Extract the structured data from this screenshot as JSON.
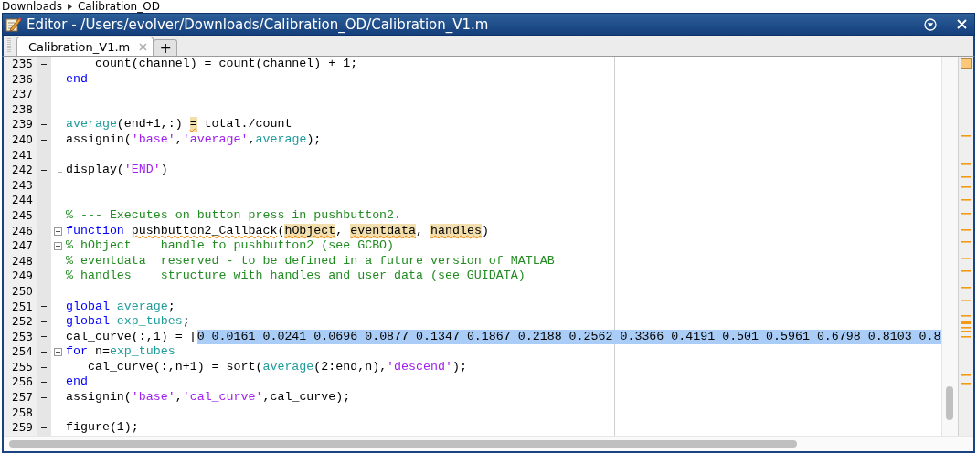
{
  "breadcrumb": [
    {
      "label": "Downloads"
    },
    {
      "label": "Calibration_OD"
    }
  ],
  "window": {
    "title": "Editor - /Users/evolver/Downloads/Calibration_OD/Calibration_V1.m"
  },
  "tabs": [
    {
      "label": "Calibration_V1.m",
      "selected": true
    }
  ],
  "new_tab_label": "+",
  "code_lines": [
    {
      "number": "235",
      "executable": true,
      "in_block": true,
      "tokens": [
        {
          "kind": "plain",
          "text": "    count(channel) = count(channel) + 1;"
        }
      ]
    },
    {
      "number": "236",
      "executable": true,
      "in_block": true,
      "tokens": [
        {
          "kind": "keyword",
          "text": "end"
        }
      ]
    },
    {
      "number": "237",
      "executable": false,
      "in_block": true
    },
    {
      "number": "238",
      "executable": false,
      "in_block": true
    },
    {
      "number": "239",
      "executable": true,
      "in_block": true,
      "tokens": [
        {
          "kind": "variable",
          "text": "average"
        },
        {
          "kind": "plain",
          "text": "(end+1,:) "
        },
        {
          "kind": "highlight",
          "text": "="
        },
        {
          "kind": "plain",
          "text": " total./count"
        }
      ]
    },
    {
      "number": "240",
      "executable": true,
      "in_block": true,
      "tokens": [
        {
          "kind": "plain",
          "text": "assignin("
        },
        {
          "kind": "string",
          "text": "'base'"
        },
        {
          "kind": "plain",
          "text": ","
        },
        {
          "kind": "string",
          "text": "'average'"
        },
        {
          "kind": "plain",
          "text": ","
        },
        {
          "kind": "variable",
          "text": "average"
        },
        {
          "kind": "plain",
          "text": ");"
        }
      ]
    },
    {
      "number": "241",
      "executable": false,
      "in_block": true
    },
    {
      "number": "242",
      "executable": true,
      "in_block": true,
      "tokens": [
        {
          "kind": "plain",
          "text": "display("
        },
        {
          "kind": "string",
          "text": "'END'"
        },
        {
          "kind": "plain",
          "text": ")"
        }
      ]
    },
    {
      "number": "243",
      "executable": false,
      "in_block": false
    },
    {
      "number": "244",
      "executable": false,
      "in_block": false
    },
    {
      "number": "245",
      "executable": false,
      "in_block": false,
      "tokens": [
        {
          "kind": "comment",
          "text": "% --- Executes on button press in pushbutton2."
        }
      ]
    },
    {
      "number": "246",
      "executable": false,
      "expanded": true,
      "tokens": [
        {
          "kind": "keyword",
          "text": "function "
        },
        {
          "kind": "warning",
          "text": "pushbutton2_Callback"
        },
        {
          "kind": "plain",
          "text": "("
        },
        {
          "kind": "highlight",
          "text": "hObject"
        },
        {
          "kind": "plain",
          "text": ", "
        },
        {
          "kind": "highlight",
          "text": "eventdata"
        },
        {
          "kind": "plain",
          "text": ", "
        },
        {
          "kind": "highlight",
          "text": "handles"
        },
        {
          "kind": "plain",
          "text": ")"
        }
      ]
    },
    {
      "number": "247",
      "executable": false,
      "expanded": true,
      "tokens": [
        {
          "kind": "comment",
          "text": "% hObject    handle to pushbutton2 (see GCBO)"
        }
      ]
    },
    {
      "number": "248",
      "executable": false,
      "in_block": true,
      "tokens": [
        {
          "kind": "comment",
          "text": "% eventdata  reserved - to be defined in a future version of MATLAB"
        }
      ]
    },
    {
      "number": "249",
      "executable": false,
      "in_block": true,
      "tokens": [
        {
          "kind": "comment",
          "text": "% handles    structure with handles and user data (see GUIDATA)"
        }
      ]
    },
    {
      "number": "250",
      "executable": false,
      "in_block": true
    },
    {
      "number": "251",
      "executable": true,
      "in_block": true,
      "tokens": [
        {
          "kind": "keyword",
          "text": "global "
        },
        {
          "kind": "variable",
          "text": "average"
        },
        {
          "kind": "plain",
          "text": ";"
        }
      ]
    },
    {
      "number": "252",
      "executable": true,
      "in_block": true,
      "tokens": [
        {
          "kind": "keyword",
          "text": "global "
        },
        {
          "kind": "variable",
          "text": "exp_tubes"
        },
        {
          "kind": "plain",
          "text": ";"
        }
      ]
    },
    {
      "number": "253",
      "executable": true,
      "in_block": true,
      "tokens": [
        {
          "kind": "plain",
          "text": "cal_curve(:,1) = ["
        },
        {
          "kind": "selection",
          "text": "0 0.0161 0.0241 0.0696 0.0877 0.1347 0.1867 0.2188 0.2562 0.3366 0.4191 0.501 0.5961 0.6798 0.8103 0.8"
        }
      ]
    },
    {
      "number": "254",
      "executable": true,
      "expanded": true,
      "tokens": [
        {
          "kind": "keyword",
          "text": "for"
        },
        {
          "kind": "plain",
          "text": " n="
        },
        {
          "kind": "variable",
          "text": "exp_tubes"
        }
      ]
    },
    {
      "number": "255",
      "executable": true,
      "in_block": true,
      "tokens": [
        {
          "kind": "plain",
          "text": "   cal_curve(:,n+1) = sort("
        },
        {
          "kind": "variable",
          "text": "average"
        },
        {
          "kind": "plain",
          "text": "(2:end,n),"
        },
        {
          "kind": "string",
          "text": "'descend'"
        },
        {
          "kind": "plain",
          "text": ");"
        }
      ]
    },
    {
      "number": "256",
      "executable": true,
      "in_block": true,
      "tokens": [
        {
          "kind": "keyword",
          "text": "end"
        }
      ]
    },
    {
      "number": "257",
      "executable": true,
      "in_block": true,
      "tokens": [
        {
          "kind": "plain",
          "text": "assignin("
        },
        {
          "kind": "string",
          "text": "'base'"
        },
        {
          "kind": "plain",
          "text": ","
        },
        {
          "kind": "string",
          "text": "'cal_curve'"
        },
        {
          "kind": "plain",
          "text": ",cal_curve);"
        }
      ]
    },
    {
      "number": "258",
      "executable": false,
      "in_block": true
    },
    {
      "number": "259",
      "executable": true,
      "in_block": true,
      "tokens": [
        {
          "kind": "plain",
          "text": "figure(1);"
        }
      ]
    }
  ]
}
